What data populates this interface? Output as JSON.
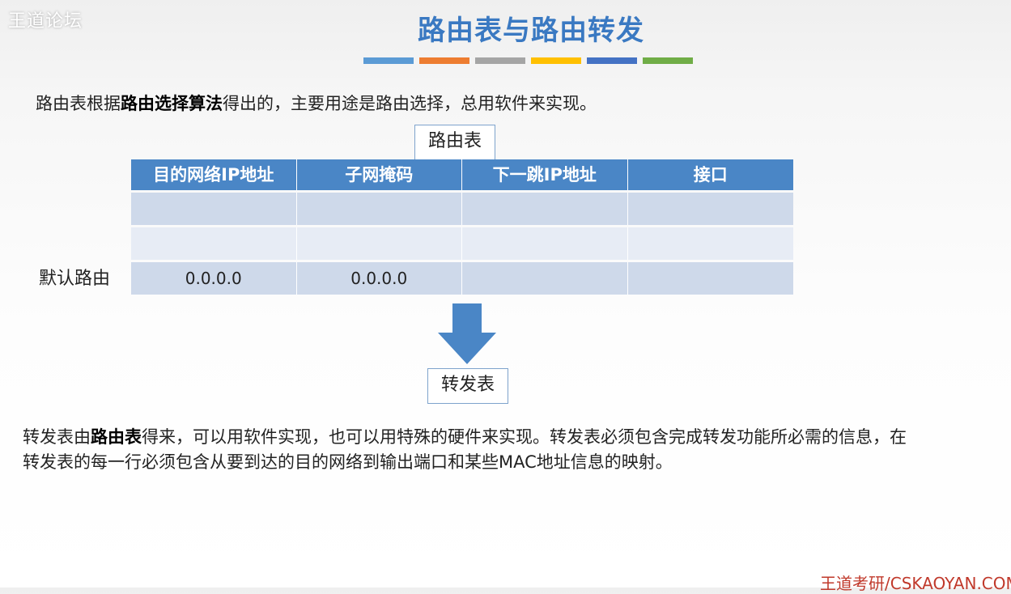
{
  "watermark": "王道论坛",
  "title": "路由表与路由转发",
  "color_bar": [
    "#5b9bd5",
    "#ed7d31",
    "#a5a5a5",
    "#ffc000",
    "#4472c4",
    "#70ad47"
  ],
  "intro": {
    "part1": "路由表根据",
    "bold": "路由选择算法",
    "part2": "得出的，主要用途是路由选择，总用软件来实现。"
  },
  "routing_table_label": "路由表",
  "table": {
    "headers": [
      "目的网络IP地址",
      "子网掩码",
      "下一跳IP地址",
      "接口"
    ],
    "rows": [
      [
        "",
        "",
        "",
        ""
      ],
      [
        "",
        "",
        "",
        ""
      ],
      [
        "0.0.0.0",
        "0.0.0.0",
        "",
        ""
      ]
    ]
  },
  "default_route_label": "默认路由",
  "arrow_icon": "down-arrow-icon",
  "forwarding_table_label": "转发表",
  "paragraph": {
    "part1": "转发表由",
    "bold": "路由表",
    "part2": "得来，可以用软件实现，也可以用特殊的硬件来实现。转发表必须包含完成转发功能所必需的信息，在转发表的每一行必须包含从要到达的目的网络到输出端口和某些MAC地址信息的映射。"
  },
  "footer": "王道考研/CSKAOYAN.COM",
  "colors": {
    "title": "#3a79c2",
    "header_bg": "#4a86c6",
    "row_bg": "#ced9ea",
    "row_alt_bg": "#e7ecf5",
    "footer": "#c0392b"
  }
}
